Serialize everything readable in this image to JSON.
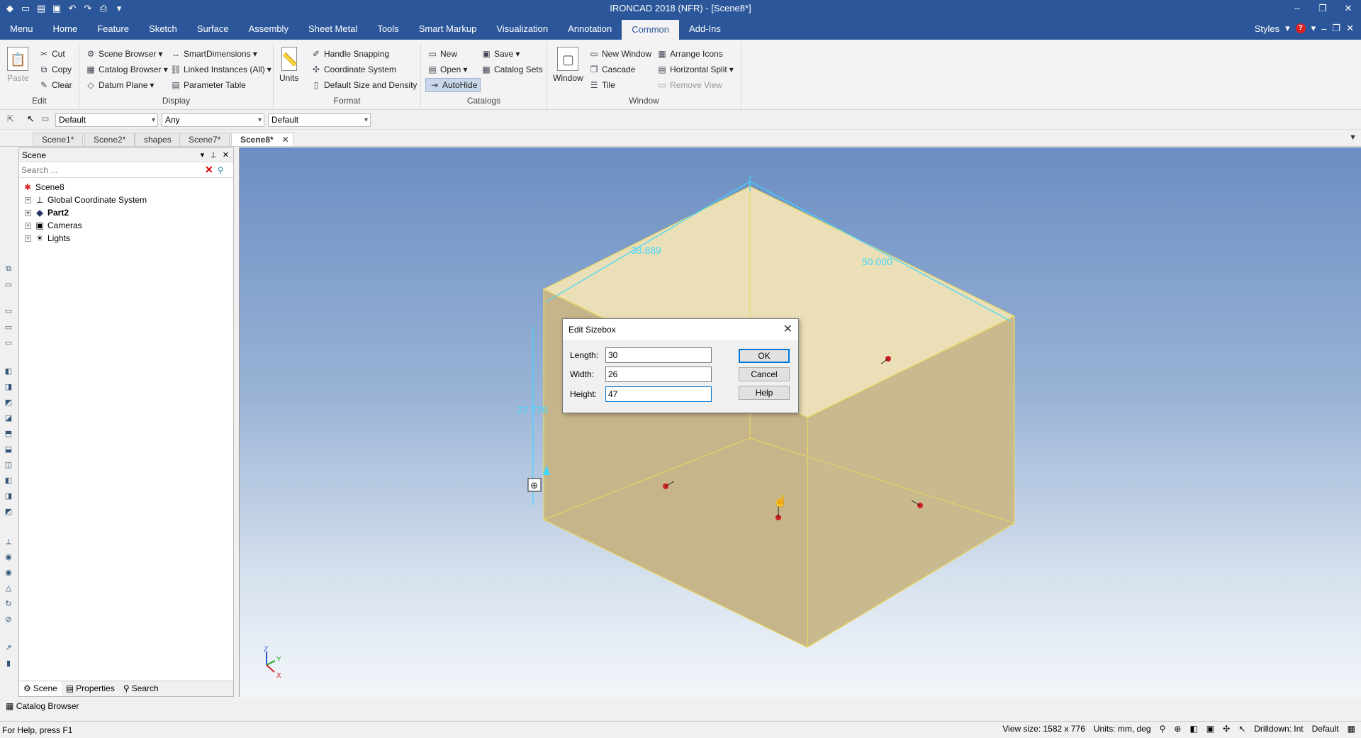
{
  "app": {
    "title": "IRONCAD 2018 (NFR) - [Scene8*]"
  },
  "window_controls": [
    "–",
    "❐",
    "✕"
  ],
  "menu": {
    "tabs": [
      "Menu",
      "Home",
      "Feature",
      "Sketch",
      "Surface",
      "Assembly",
      "Sheet Metal",
      "Tools",
      "Smart Markup",
      "Visualization",
      "Annotation",
      "Common",
      "Add-Ins"
    ],
    "active": "Common",
    "styles_label": "Styles"
  },
  "ribbon": {
    "edit": {
      "label": "Edit",
      "paste": "Paste",
      "cut": "Cut",
      "copy": "Copy",
      "clear": "Clear"
    },
    "display": {
      "label": "Display",
      "scene_browser": "Scene Browser",
      "catalog_browser": "Catalog Browser",
      "datum_plane": "Datum Plane",
      "smart_dimensions": "SmartDimensions",
      "linked_instances": "Linked Instances (All)",
      "parameter_table": "Parameter Table"
    },
    "format": {
      "label": "Format",
      "units": "Units",
      "handle_snapping": "Handle Snapping",
      "coordinate_system": "Coordinate System",
      "default_size": "Default Size and Density"
    },
    "catalogs": {
      "label": "Catalogs",
      "new": "New",
      "open": "Open",
      "autohide": "AutoHide",
      "save": "Save",
      "catalog_sets": "Catalog Sets"
    },
    "window": {
      "label": "Window",
      "window": "Window",
      "new_window": "New Window",
      "cascade": "Cascade",
      "tile": "Tile",
      "arrange_icons": "Arrange Icons",
      "horizontal_split": "Horizontal Split",
      "remove_view": "Remove View"
    }
  },
  "toolbar2": {
    "combo1": "Default",
    "combo2": "Any",
    "combo3": "Default"
  },
  "doc_tabs": [
    "Scene1*",
    "Scene2*",
    "shapes",
    "Scene7*",
    "Scene8*"
  ],
  "scene_panel": {
    "title": "Scene",
    "search_placeholder": "Search ...",
    "root": "Scene8",
    "items": [
      "Global Coordinate System",
      "Part2",
      "Cameras",
      "Lights"
    ],
    "bottom_tabs": [
      "Scene",
      "Properties",
      "Search"
    ]
  },
  "catalog_browser": "Catalog Browser",
  "viewport": {
    "dims": {
      "top_left": "38.889",
      "top_right": "50.000",
      "left": "27.778"
    },
    "triad": {
      "z": "Z",
      "y": "Y",
      "x": "X"
    }
  },
  "dialog": {
    "title": "Edit Sizebox",
    "length_label": "Length:",
    "length": "30",
    "width_label": "Width:",
    "width": "26",
    "height_label": "Height:",
    "height": "47",
    "ok": "OK",
    "cancel": "Cancel",
    "help": "Help"
  },
  "status": {
    "help": "For Help, press F1",
    "view_size": "View size: 1582 x  776",
    "units": "Units: mm, deg",
    "drilldown": "Drilldown: Int",
    "mode": "Default"
  }
}
